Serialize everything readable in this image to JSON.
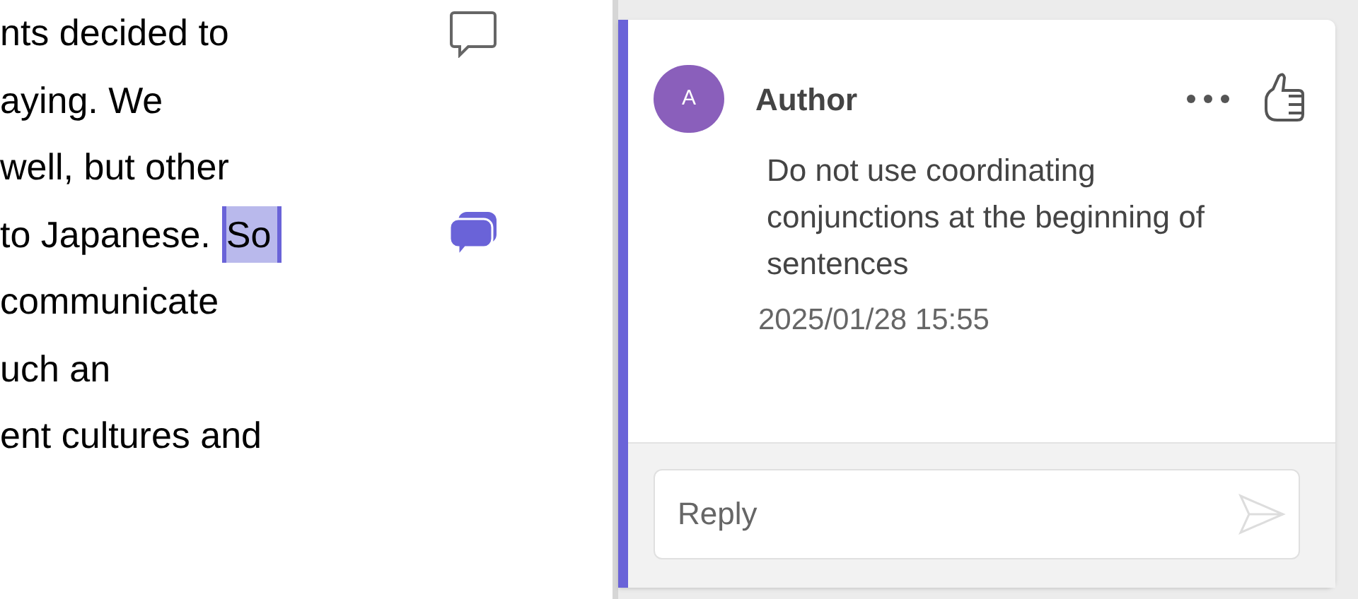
{
  "document": {
    "lines": [
      {
        "text": "nts decided to",
        "marker": {
          "selected": false
        }
      },
      {
        "text": "aying. We"
      },
      {
        "text": "well, but other"
      },
      {
        "text": "to Japanese.",
        "highlight": "So",
        "marker": {
          "selected": true
        }
      },
      {
        "text": "communicate"
      },
      {
        "text": "uch an"
      },
      {
        "text": "ent cultures and"
      }
    ]
  },
  "comment": {
    "avatar": "A",
    "author": "Author",
    "body": "Do not use coordinating conjunctions at the beginning of sentences",
    "date": "2025/01/28 15:55",
    "liked": false,
    "reply": {
      "placeholder": "Reply"
    }
  }
}
